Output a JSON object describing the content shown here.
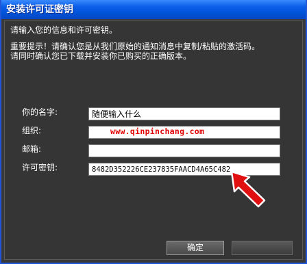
{
  "window": {
    "title": "安装许可证密钥"
  },
  "dialog": {
    "intro": "请输入您的信息和许可密钥。",
    "notice_line1": "重要提示！请确认您是从我们原始的通知消息中复制/粘贴的激活码。",
    "notice_line2": "请同时确认您已下载并安装你已购买的正确版本。"
  },
  "form": {
    "name_label": "你的名字:",
    "name_value": "随便输入什么",
    "org_label": "组织:",
    "org_value": "",
    "email_label": "邮箱:",
    "email_value": "",
    "key_label": "许可密钥:",
    "key_value": "8482D352226CE237835FAACD4A65C482"
  },
  "watermark": "www.qinpinchang.com",
  "buttons": {
    "ok_label": "确定",
    "other_label": ""
  },
  "colors": {
    "titlebar": "#0b5ee8",
    "background": "#353535",
    "watermark": "#e10000",
    "arrow": "#e01010"
  },
  "icons": {
    "pointer_arrow": "red-arrow-icon"
  }
}
